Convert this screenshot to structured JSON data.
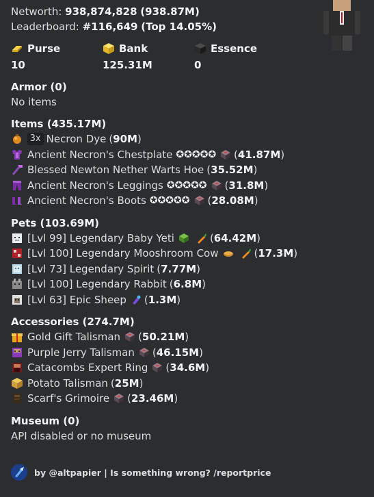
{
  "networth": {
    "label": "Networth:",
    "value": "938,874,828",
    "short": "(938.87M)"
  },
  "leaderboard": {
    "label": "Leaderboard:",
    "rank": "#116,649",
    "top": "(Top 14.05%)"
  },
  "stats": [
    {
      "name": "Purse",
      "value": "10",
      "icon": "gold-ingot-icon"
    },
    {
      "name": "Bank",
      "value": "125.31M",
      "icon": "gold-block-icon"
    },
    {
      "name": "Essence",
      "value": "0",
      "icon": "essence-icon"
    }
  ],
  "armor": {
    "title": "Armor (0)",
    "empty": "No items"
  },
  "items": {
    "title": "Items (435.17M)",
    "rows": [
      {
        "qty": "3x",
        "name": "Necron Dye",
        "stars": "",
        "price": "90M",
        "icon": "dye-icon"
      },
      {
        "qty": "",
        "name": "Ancient Necron's Chestplate",
        "stars": "✪✪✪✪✪",
        "price": "41.87M",
        "icon": "chestplate-icon"
      },
      {
        "qty": "",
        "name": "Blessed Newton Nether Warts Hoe",
        "stars": "",
        "price": "35.52M",
        "icon": "hoe-icon"
      },
      {
        "qty": "",
        "name": "Ancient Necron's Leggings",
        "stars": "✪✪✪✪✪",
        "price": "31.8M",
        "icon": "leggings-icon"
      },
      {
        "qty": "",
        "name": "Ancient Necron's Boots",
        "stars": "✪✪✪✪✪",
        "price": "28.08M",
        "icon": "boots-icon"
      }
    ]
  },
  "pets": {
    "title": "Pets (103.69M)",
    "rows": [
      {
        "name": "[Lvl 99] Legendary Baby Yeti",
        "price": "64.42M",
        "icon": "yeti-icon",
        "extras": [
          "minos-relic-icon",
          "carrot-icon"
        ]
      },
      {
        "name": "[Lvl 100] Legendary Mooshroom Cow",
        "price": "17.3M",
        "icon": "mooshroom-icon",
        "extras": [
          "bread-icon",
          "carrot-icon"
        ]
      },
      {
        "name": "[Lvl 73] Legendary Spirit",
        "price": "7.77M",
        "icon": "spirit-icon",
        "extras": []
      },
      {
        "name": "[Lvl 100] Legendary Rabbit",
        "price": "6.8M",
        "icon": "rabbit-icon",
        "extras": []
      },
      {
        "name": "[Lvl 63] Epic Sheep",
        "price": "1.3M",
        "icon": "sheep-icon",
        "extras": [
          "dye-item-icon"
        ]
      }
    ]
  },
  "accessories": {
    "title": "Accessories (274.7M)",
    "rows": [
      {
        "name": "Gold Gift Talisman",
        "price": "50.21M",
        "icon": "gift-icon"
      },
      {
        "name": "Purple Jerry Talisman",
        "price": "46.15M",
        "icon": "purple-jerry-icon"
      },
      {
        "name": "Catacombs Expert Ring",
        "price": "34.6M",
        "icon": "ring-icon"
      },
      {
        "name": "Potato Talisman",
        "price": "25M",
        "icon": "potato-icon"
      },
      {
        "name": "Scarf's Grimoire",
        "price": "23.46M",
        "icon": "grimoire-icon"
      }
    ]
  },
  "museum": {
    "title": "Museum (0)",
    "text": "API disabled or no museum"
  },
  "footer": {
    "text": "by @altpapier | Is something wrong? /reportprice"
  },
  "colors": {
    "background": "#2b2d31",
    "text": "#dbdee1",
    "bold": "#f2f3f5",
    "recomb": "#4a3b40"
  }
}
